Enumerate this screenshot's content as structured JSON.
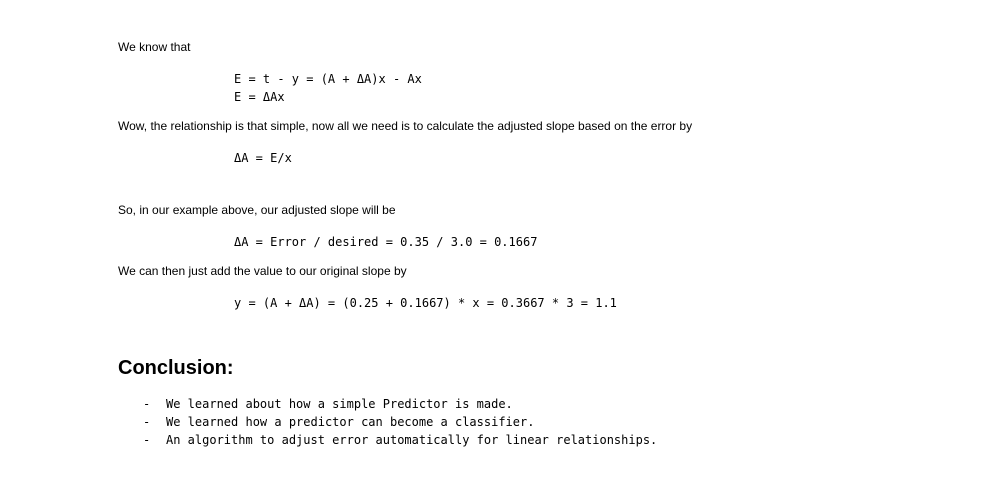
{
  "paragraphs": {
    "p1": "We know that",
    "p2": "Wow, the relationship is that simple, now all we need is to calculate the adjusted slope based on the error by",
    "p3": "So, in our example above, our adjusted slope will be",
    "p4": "We can then just add the value to our original slope by"
  },
  "code": {
    "eq1_line1": "E = t - y = (A + ΔA)x - Ax",
    "eq1_line2": "E = ΔAx",
    "eq2": "ΔA = E/x",
    "eq3": "ΔA = Error / desired = 0.35 / 3.0 = 0.1667",
    "eq4": "y = (A + ΔA) = (0.25 + 0.1667) * x = 0.3667 * 3 = 1.1"
  },
  "conclusion": {
    "heading": "Conclusion:",
    "bullet_marker": "-",
    "items": [
      "We learned about how a simple Predictor is made.",
      "We learned how a predictor can become a classifier.",
      "An algorithm to adjust error automatically for linear relationships."
    ]
  }
}
